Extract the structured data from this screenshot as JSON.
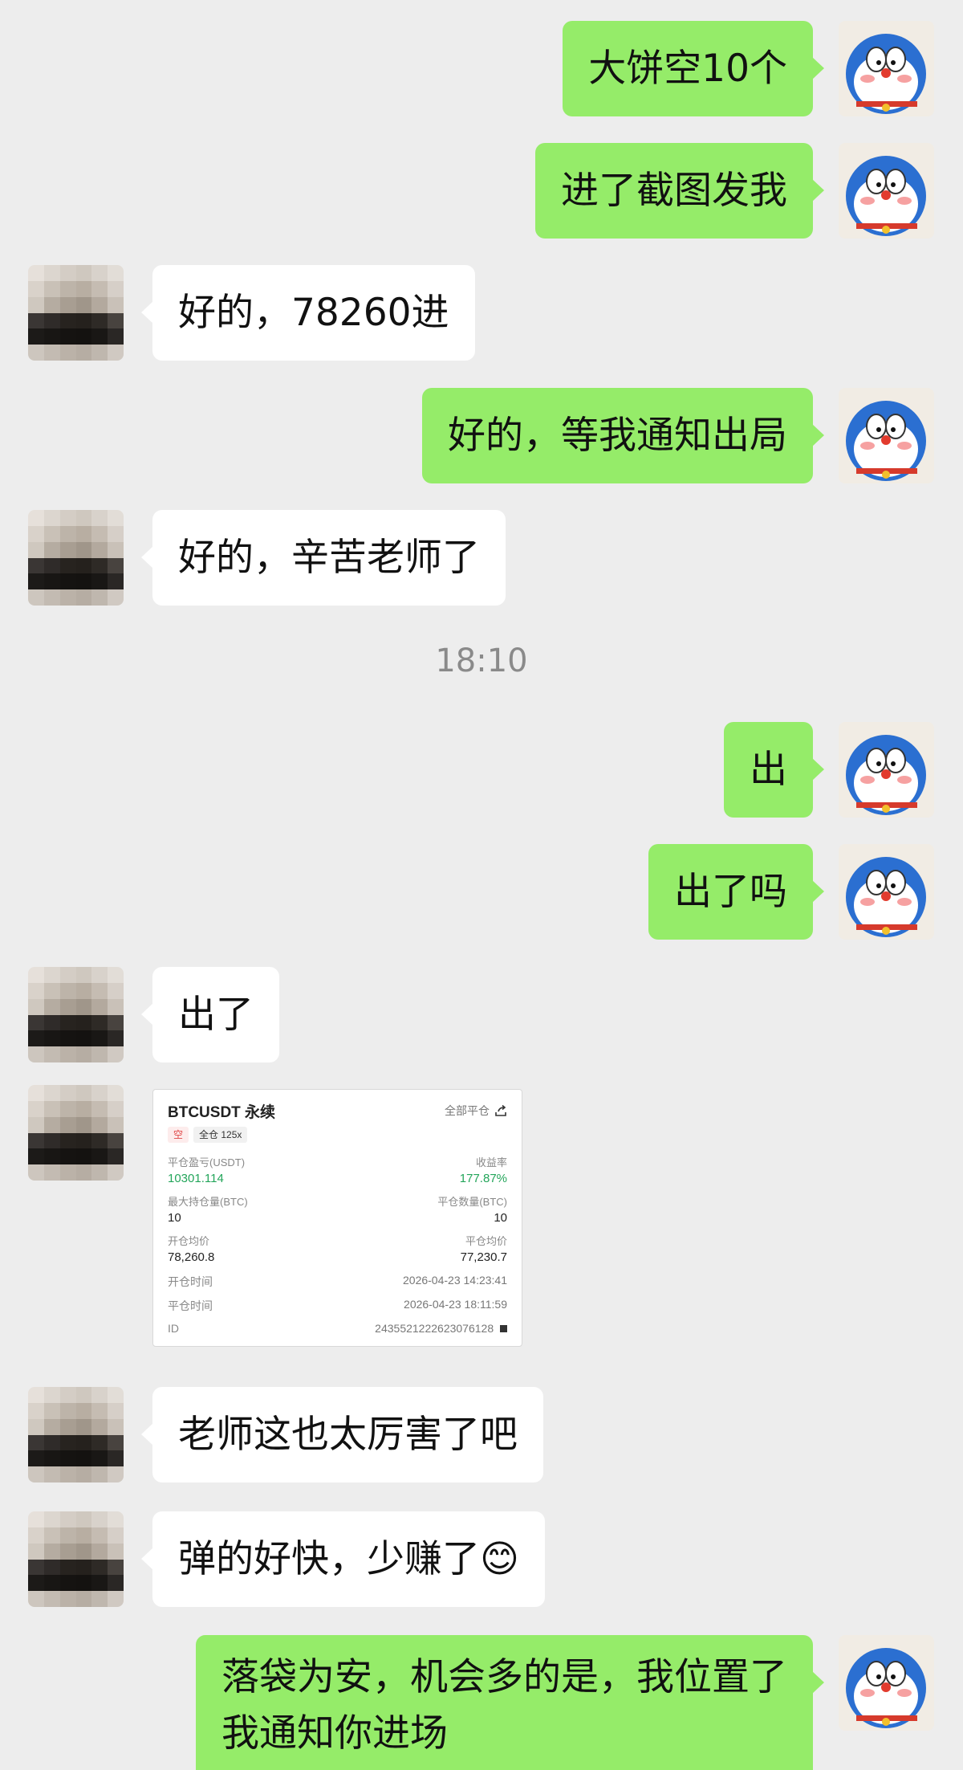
{
  "messages": [
    {
      "text": "大饼空10个"
    },
    {
      "text": "进了截图发我"
    },
    {
      "text": "好的，78260进"
    },
    {
      "text": "好的，等我通知出局"
    },
    {
      "text": "好的，辛苦老师了"
    },
    {
      "text": "出"
    },
    {
      "text": "出了吗"
    },
    {
      "text": "出了"
    },
    {
      "text": "老师这也太厉害了吧"
    },
    {
      "text": "弹的好快，少赚了😊"
    },
    {
      "text": "落袋为安，机会多的是，我位置了"
    },
    {
      "text": "我通知你进场"
    }
  ],
  "timestamp": "18:10",
  "card": {
    "title": "BTCUSDT 永续",
    "action": "全部平仓",
    "tag_side": "空",
    "tag_mode": "全仓 125x",
    "pnl_label": "平仓盈亏(USDT)",
    "pnl_value": "10301.114",
    "roi_label": "收益率",
    "roi_value": "177.87%",
    "max_pos_label": "最大持仓量(BTC)",
    "max_pos_value": "10",
    "close_qty_label": "平仓数量(BTC)",
    "close_qty_value": "10",
    "open_avg_label": "开仓均价",
    "open_avg_value": "78,260.8",
    "close_avg_label": "平仓均价",
    "close_avg_value": "77,230.7",
    "open_time_label": "开仓时间",
    "open_time_value": "2026-04-23 14:23:41",
    "close_time_label": "平仓时间",
    "close_time_value": "2026-04-23 18:11:59",
    "id_label": "ID",
    "id_value": "2435521222623076128"
  },
  "colors": {
    "my_bubble": "#95ec69",
    "their_bubble": "#ffffff",
    "background": "#ededed",
    "profit_green": "#23a55a"
  }
}
